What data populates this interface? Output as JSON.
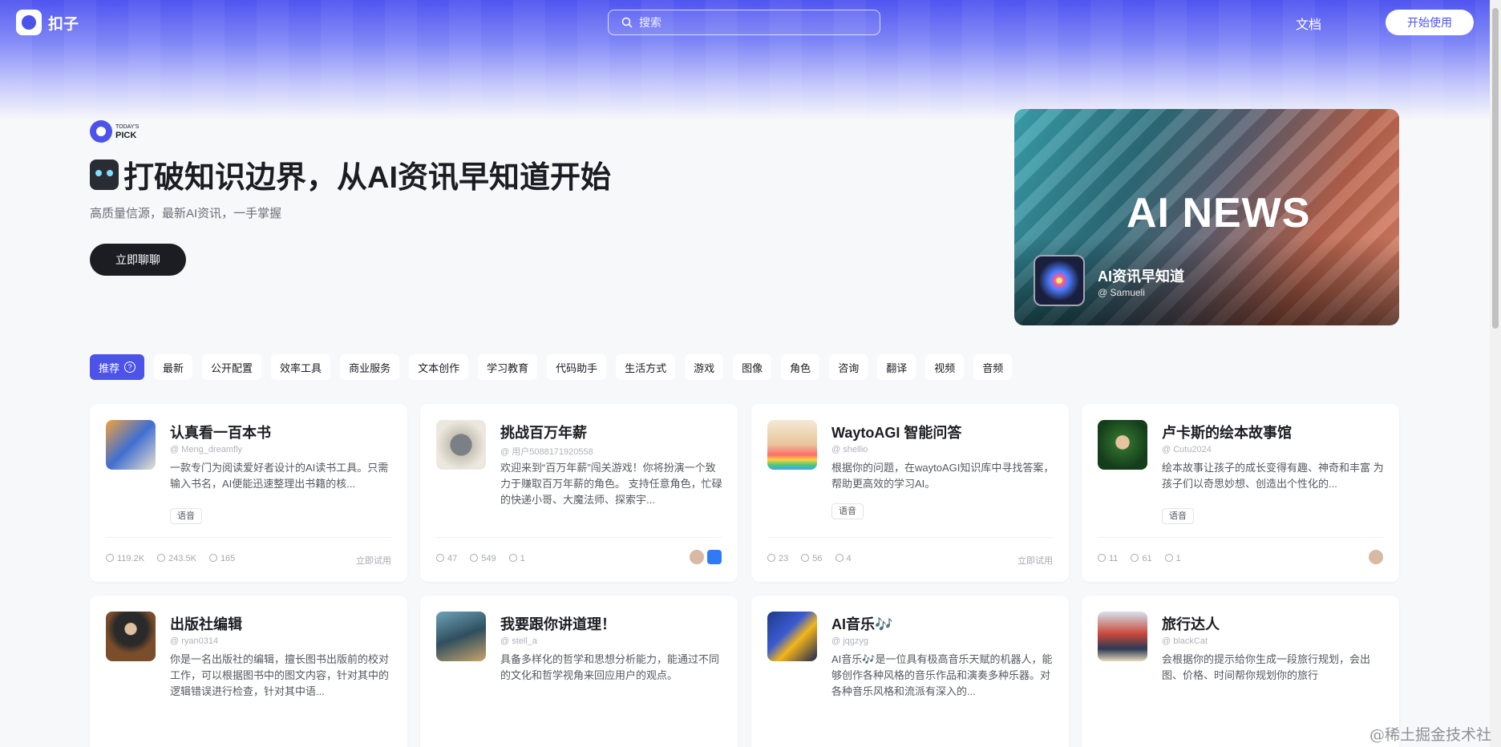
{
  "header": {
    "logo_text": "扣子",
    "search_placeholder": "搜索",
    "docs": "文档",
    "start": "开始使用"
  },
  "hero": {
    "pick_small": "TODAY'S",
    "pick_big": "PICK",
    "title": "打破知识边界，从AI资讯早知道开始",
    "subtitle": "高质量信源，最新AI资讯，一手掌握",
    "cta": "立即聊聊"
  },
  "banner": {
    "big_text": "AI NEWS",
    "title": "AI资讯早知道",
    "author": "@ Samueli"
  },
  "categories": [
    "推荐",
    "最新",
    "公开配置",
    "效率工具",
    "商业服务",
    "文本创作",
    "学习教育",
    "代码助手",
    "生活方式",
    "游戏",
    "图像",
    "角色",
    "咨询",
    "翻译",
    "视频",
    "音频"
  ],
  "cards": [
    {
      "name": "认真看一百本书",
      "author": "@ Meng_dreamfly",
      "desc": "一款专门为阅读爱好者设计的AI读书工具。只需输入书名，AI便能迅速整理出书籍的核...",
      "tag": "语音",
      "users": "119.2K",
      "chats": "243.5K",
      "stars": "165",
      "try": "立即试用"
    },
    {
      "name": "挑战百万年薪",
      "author": "@ 用户5088171920558",
      "desc": "欢迎来到“百万年薪”闯关游戏！你将扮演一个致力于赚取百万年薪的角色。 支持任意角色，忙碌的快递小哥、大魔法师、探索宇...",
      "tag": "",
      "users": "47",
      "chats": "549",
      "stars": "1",
      "try": ""
    },
    {
      "name": "WaytoAGI 智能问答",
      "author": "@ shellio",
      "desc": "根据你的问题，在waytoAGI知识库中寻找答案，帮助更高效的学习AI。",
      "tag": "语音",
      "users": "23",
      "chats": "56",
      "stars": "4",
      "try": "立即试用"
    },
    {
      "name": "卢卡斯的绘本故事馆",
      "author": "@ Cutu2024",
      "desc": "绘本故事让孩子的成长变得有趣、神奇和丰富 为孩子们以奇思妙想、创造出个性化的...",
      "tag": "语音",
      "users": "11",
      "chats": "61",
      "stars": "1",
      "try": ""
    },
    {
      "name": "出版社编辑",
      "author": "@ ryan0314",
      "desc": "你是一名出版社的编辑，擅长图书出版前的校对工作，可以根据图书中的图文内容，针对其中的逻辑错误进行检查，针对其中语...",
      "tag": "",
      "users": "",
      "chats": "",
      "stars": "",
      "try": ""
    },
    {
      "name": "我要跟你讲道理！",
      "author": "@ stell_a",
      "desc": "具备多样化的哲学和思想分析能力，能通过不同的文化和哲学视角来回应用户的观点。",
      "tag": "",
      "users": "",
      "chats": "",
      "stars": "",
      "try": ""
    },
    {
      "name": "AI音乐🎶",
      "author": "@ jqgzyg",
      "desc": "AI音乐🎶是一位具有极高音乐天赋的机器人，能够创作各种风格的音乐作品和演奏多种乐器。对各种音乐风格和流派有深入的...",
      "tag": "",
      "users": "",
      "chats": "",
      "stars": "",
      "try": ""
    },
    {
      "name": "旅行达人",
      "author": "@ blackCat",
      "desc": "会根据你的提示给你生成一段旅行规划，会出图、价格、时间帮你规划你的旅行",
      "tag": "",
      "users": "",
      "chats": "",
      "stars": "",
      "try": ""
    }
  ],
  "watermark": "@稀土掘金技术社区",
  "colors": {
    "accent": "#4d53e8",
    "dark": "#1c1d23"
  }
}
